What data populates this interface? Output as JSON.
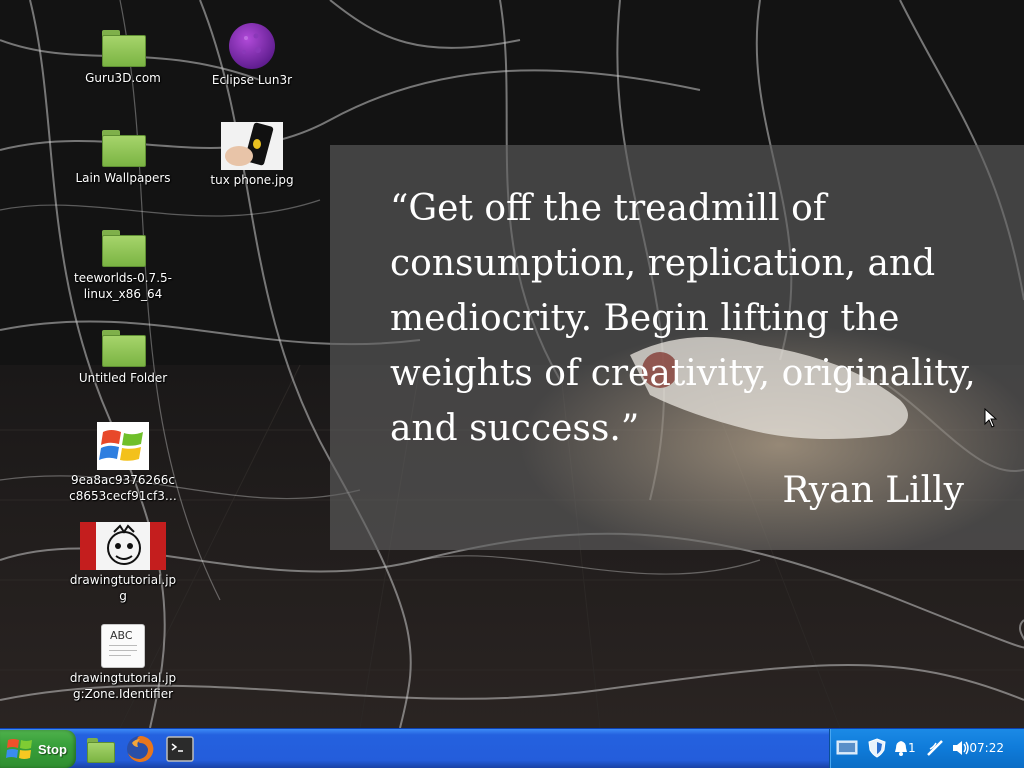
{
  "desktop": {
    "icons": [
      {
        "label": "Guru3D.com",
        "icon": "folder-icon"
      },
      {
        "label": "Eclipse Lun3r",
        "icon": "eclipse-orb-icon"
      },
      {
        "label": "Lain Wallpapers",
        "icon": "folder-icon"
      },
      {
        "label": "tux phone.jpg",
        "icon": "image-thumbnail-icon"
      },
      {
        "label": "teeworlds-0.7.5-linux_x86_64",
        "icon": "folder-icon"
      },
      {
        "label": "Untitled Folder",
        "icon": "folder-icon"
      },
      {
        "label": "9ea8ac9376266cc8653cecf91cf3…",
        "icon": "windows-logo-icon"
      },
      {
        "label": "drawingtutorial.jpg",
        "icon": "image-thumbnail-icon"
      },
      {
        "label": "drawingtutorial.jpg:Zone.Identifier",
        "icon": "text-document-icon"
      }
    ]
  },
  "wallpaper": {
    "quote": "“Get off the treadmill of consumption, replication, and mediocrity. Begin lifting the weights of creativity, originality, and success.”",
    "author": "Ryan Lilly"
  },
  "text_doc_icon_glyph": "ABC",
  "taskbar": {
    "start_label": "Stop",
    "quick_launch": [
      "file-manager-icon",
      "firefox-icon",
      "terminal-icon"
    ],
    "tray": {
      "icons": [
        "display-icon",
        "shield-icon",
        "notification-icon",
        "network-icon",
        "volume-icon"
      ],
      "notification_count": "1",
      "clock": "07:22"
    }
  },
  "colors": {
    "taskbar_blue": "#245ddb",
    "start_green": "#38a03a",
    "tray_blue": "#0f7bd9",
    "quote_overlay": "#5f5f5f",
    "folder_green": "#8cc157"
  }
}
